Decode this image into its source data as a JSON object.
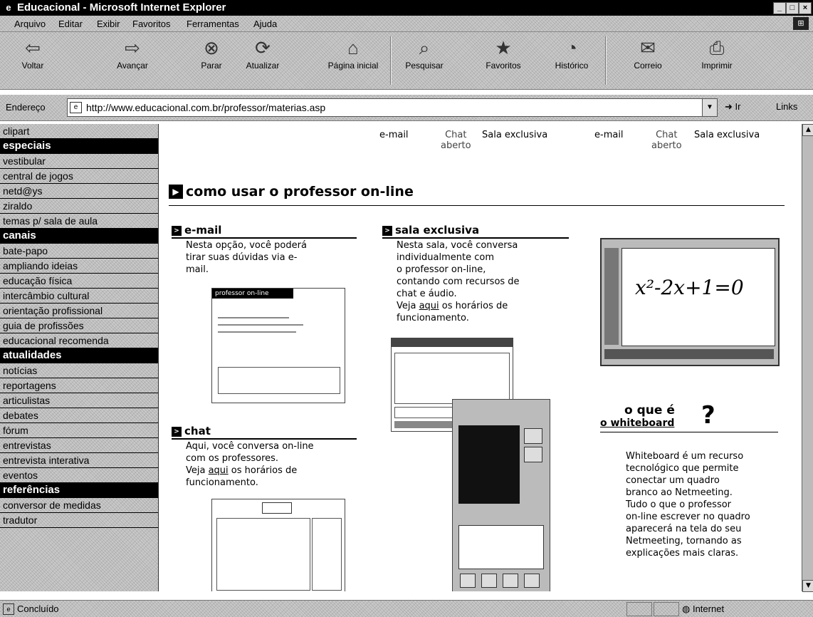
{
  "window": {
    "title": "Educacional - Microsoft Internet Explorer"
  },
  "menu": [
    "Arquivo",
    "Editar",
    "Exibir",
    "Favoritos",
    "Ferramentas",
    "Ajuda"
  ],
  "toolbar": [
    "Voltar",
    "Avançar",
    "Parar",
    "Atualizar",
    "Página inicial",
    "Pesquisar",
    "Favoritos",
    "Histórico",
    "Correio",
    "Imprimir"
  ],
  "address": {
    "label": "Endereço",
    "url": "http://www.educacional.com.br/professor/materias.asp",
    "go": "Ir",
    "links": "Links"
  },
  "sidebar": [
    {
      "label": "clipart",
      "head": false
    },
    {
      "label": "especiais",
      "head": true
    },
    {
      "label": "vestibular",
      "head": false
    },
    {
      "label": "central de jogos",
      "head": false
    },
    {
      "label": "netd@ys",
      "head": false
    },
    {
      "label": "ziraldo",
      "head": false
    },
    {
      "label": "temas p/ sala de aula",
      "head": false
    },
    {
      "label": "canais",
      "head": true
    },
    {
      "label": "bate-papo",
      "head": false
    },
    {
      "label": "ampliando ideias",
      "head": false
    },
    {
      "label": "educação física",
      "head": false
    },
    {
      "label": "intercâmbio cultural",
      "head": false
    },
    {
      "label": "orientação profissional",
      "head": false
    },
    {
      "label": "guia de profissões",
      "head": false
    },
    {
      "label": "educacional recomenda",
      "head": false
    },
    {
      "label": "atualidades",
      "head": true
    },
    {
      "label": "notícias",
      "head": false
    },
    {
      "label": "reportagens",
      "head": false
    },
    {
      "label": "articulistas",
      "head": false
    },
    {
      "label": "debates",
      "head": false
    },
    {
      "label": "fórum",
      "head": false
    },
    {
      "label": "entrevistas",
      "head": false
    },
    {
      "label": "entrevista interativa",
      "head": false
    },
    {
      "label": "eventos",
      "head": false
    },
    {
      "label": "referências",
      "head": true
    },
    {
      "label": "conversor de medidas",
      "head": false
    },
    {
      "label": "tradutor",
      "head": false
    }
  ],
  "top_links": {
    "email": "e-mail",
    "chat_line1": "Chat",
    "chat_line2": "aberto",
    "sala": "Sala exclusiva"
  },
  "section_title": "como usar o professor on-line",
  "email_block": {
    "heading": "e-mail",
    "lines": [
      "Nesta opção, você poderá",
      "tirar suas dúvidas via e-",
      "mail."
    ]
  },
  "sala_block": {
    "heading": "sala exclusiva",
    "lines": [
      "Nesta sala, você conversa",
      "individualmente com",
      "o professor on-line,",
      "contando com recursos de",
      "chat e áudio."
    ],
    "link_pre": "Veja ",
    "link": "aqui",
    "link_post": " os horários de",
    "last": "funcionamento."
  },
  "chat_block": {
    "heading": "chat",
    "lines": [
      "Aqui, você conversa on-line",
      "com os professores."
    ],
    "link_pre": "Veja ",
    "link": "aqui",
    "link_post": " os horários de",
    "last": "funcionamento."
  },
  "whiteboard": {
    "line1": "o que é",
    "line2": "o whiteboard",
    "q": "?",
    "equation": "x²-2x+1=0",
    "desc": [
      "Whiteboard é um recurso",
      "tecnológico que permite",
      "conectar um quadro",
      "branco ao Netmeeting.",
      "Tudo o que o professor",
      "on-line escrever no quadro",
      "aparecerá na tela do seu",
      "Netmeeting, tornando as",
      "explicações mais claras."
    ]
  },
  "screenshots": {
    "email_form_title": "professor on-line"
  },
  "status": {
    "text": "Concluído",
    "zone": "Internet"
  }
}
